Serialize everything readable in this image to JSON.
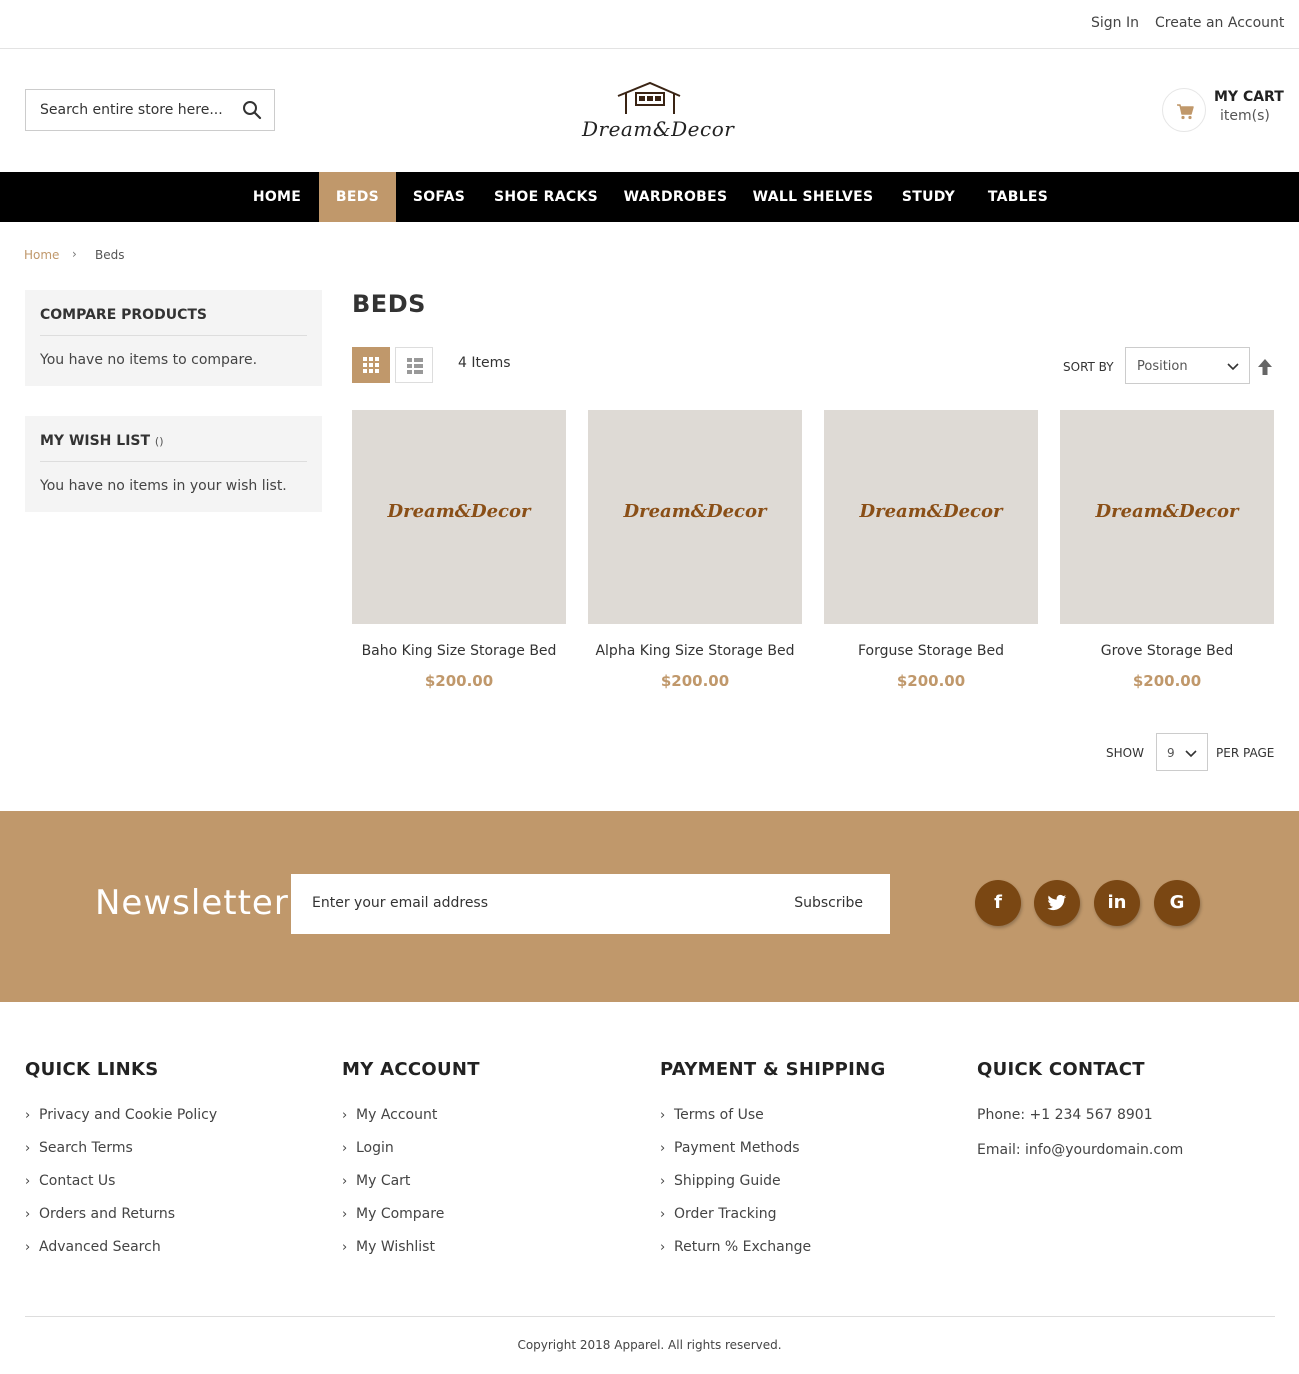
{
  "topbar": {
    "sign_in": "Sign In",
    "create_account": "Create an Account"
  },
  "header": {
    "search_placeholder": "Search entire store here...",
    "logo_text": "Dream&Decor",
    "cart_title": "MY CART",
    "cart_items": "item(s)"
  },
  "nav": [
    {
      "label": "HOME",
      "active": false
    },
    {
      "label": "BEDS",
      "active": true
    },
    {
      "label": "SOFAS",
      "active": false
    },
    {
      "label": "SHOE RACKS",
      "active": false
    },
    {
      "label": "WARDROBES",
      "active": false
    },
    {
      "label": "WALL SHELVES",
      "active": false
    },
    {
      "label": "STUDY",
      "active": false
    },
    {
      "label": "TABLES",
      "active": false
    }
  ],
  "breadcrumb": {
    "home": "Home",
    "current": "Beds"
  },
  "sidebar": {
    "compare": {
      "title": "COMPARE PRODUCTS",
      "text": "You have no items to compare."
    },
    "wishlist": {
      "title": "MY WISH LIST",
      "count": "()",
      "text": "You have no items in your wish list."
    }
  },
  "main": {
    "title": "BEDS",
    "items_count": "4 Items",
    "sort_label": "SORT BY",
    "sort_value": "Position",
    "show_label": "SHOW",
    "limit_value": "9",
    "per_page": "PER PAGE"
  },
  "products": [
    {
      "name": "Baho King Size Storage Bed",
      "price": "$200.00",
      "image_text": "Dream&Decor"
    },
    {
      "name": "Alpha King Size Storage Bed",
      "price": "$200.00",
      "image_text": "Dream&Decor"
    },
    {
      "name": "Forguse Storage Bed",
      "price": "$200.00",
      "image_text": "Dream&Decor"
    },
    {
      "name": "Grove Storage Bed",
      "price": "$200.00",
      "image_text": "Dream&Decor"
    }
  ],
  "newsletter": {
    "title": "Newsletter",
    "placeholder": "Enter your email address",
    "button": "Subscribe",
    "social": [
      {
        "icon": "facebook-icon",
        "glyph": "f"
      },
      {
        "icon": "twitter-icon",
        "glyph": "t"
      },
      {
        "icon": "linkedin-icon",
        "glyph": "in"
      },
      {
        "icon": "google-icon",
        "glyph": "G"
      }
    ]
  },
  "footer": {
    "quick_links": {
      "title": "QUICK LINKS",
      "items": [
        "Privacy and Cookie Policy",
        "Search Terms",
        "Contact Us",
        "Orders and Returns",
        "Advanced Search"
      ]
    },
    "my_account": {
      "title": "MY ACCOUNT",
      "items": [
        "My Account",
        "Login",
        "My Cart",
        "My Compare",
        "My Wishlist"
      ]
    },
    "payment_shipping": {
      "title": "PAYMENT & SHIPPING",
      "items": [
        "Terms of Use",
        "Payment Methods",
        "Shipping Guide",
        "Order Tracking",
        "Return % Exchange"
      ]
    },
    "quick_contact": {
      "title": "QUICK CONTACT",
      "phone": "Phone: +1 234 567 8901",
      "email": "Email: info@yourdomain.com"
    },
    "copyright": "Copyright 2018 Apparel. All rights reserved."
  },
  "colors": {
    "accent": "#c0986b",
    "dark_brown": "#7a4713",
    "nav_bg": "#000000",
    "image_bg": "#dedad5"
  }
}
